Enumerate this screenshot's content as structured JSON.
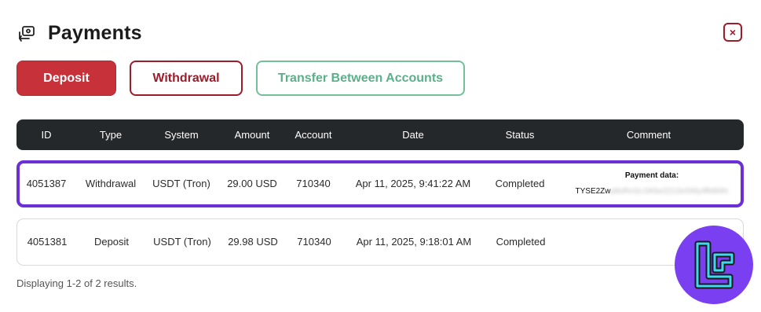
{
  "header": {
    "title": "Payments",
    "icon": "payments-icon"
  },
  "close": {
    "icon": "close-icon",
    "symbol": "×"
  },
  "tabs": [
    {
      "label": "Deposit",
      "active": true
    },
    {
      "label": "Withdrawal"
    },
    {
      "label": "Transfer Between Accounts"
    }
  ],
  "table": {
    "columns": [
      "ID",
      "Type",
      "System",
      "Amount",
      "Account",
      "Date",
      "Status",
      "Comment"
    ],
    "rows": [
      {
        "id": "4051387",
        "type": "Withdrawal",
        "system": "USDT (Tron)",
        "amount": "29.00 USD",
        "account": "710340",
        "date": "Apr 11, 2025, 9:41:22 AM",
        "status": "Completed",
        "comment_label": "Payment data:",
        "comment_visible": "TYSE2Zw",
        "comment_obscured": "p8xRcGLGKbx2213sSWy4fb8l4ln"
      },
      {
        "id": "4051381",
        "type": "Deposit",
        "system": "USDT (Tron)",
        "amount": "29.98 USD",
        "account": "710340",
        "date": "Apr 11, 2025, 9:18:01 AM",
        "status": "Completed",
        "comment_label": "",
        "comment_visible": "",
        "comment_obscured": ""
      }
    ]
  },
  "footer": {
    "summary": "Displaying 1-2 of 2 results."
  },
  "colors": {
    "deposit": "#c7323a",
    "withdrawal": "#9c1c2a",
    "transfer": "#5bb08b",
    "highlight": "#6c2fd6",
    "header_bg": "#25282b",
    "logo_bg": "#7b3ff2"
  }
}
